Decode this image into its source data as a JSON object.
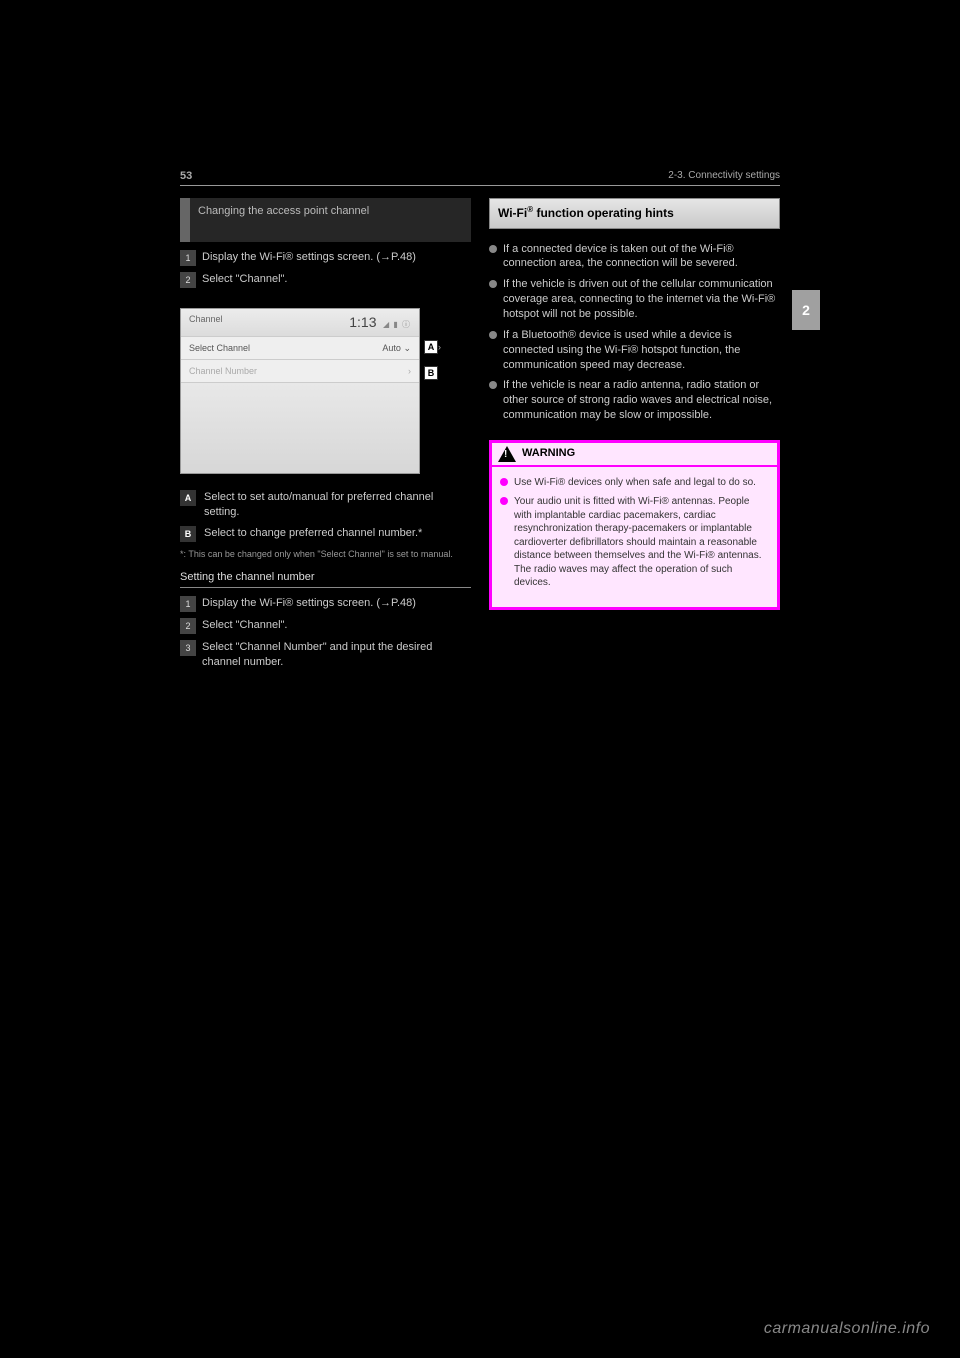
{
  "header": {
    "page_number": "53",
    "section_path": "2-3. Connectivity settings",
    "chapter_tab": "2"
  },
  "left_column": {
    "subsection_title": "Changing the access point channel",
    "steps_block1": [
      "Display the Wi-Fi® settings screen. (→P.48)",
      "Select \"Channel\"."
    ],
    "screenshot": {
      "title": "Channel",
      "time": "1:13",
      "status_icons": "◢ ▮ ⓘ",
      "row_select_label": "Select Channel",
      "row_select_value": "Auto",
      "row_select_chevron": "⌄",
      "row_select_mark": "A",
      "row_number_label": "Channel Number",
      "row_number_chevron": "›",
      "row_number_mark": "B"
    },
    "legend": [
      {
        "mark": "A",
        "text": "Select to set auto/manual for preferred channel setting."
      },
      {
        "mark": "B",
        "text": "Select to change preferred channel number.*"
      }
    ],
    "footnote": "*: This can be changed only when \"Select Channel\" is set to manual.",
    "subhead": "Setting the channel number",
    "steps_block2": [
      "Display the Wi-Fi® settings screen. (→P.48)",
      "Select \"Channel\".",
      "Select \"Channel Number\" and input the desired channel number."
    ]
  },
  "right_column": {
    "title_html": "Wi-Fi® function operating hints",
    "bullets": [
      "If a connected device is taken out of the Wi-Fi® connection area, the connection will be severed.",
      "If the vehicle is driven out of the cellular communication coverage area, connecting to the internet via the Wi-Fi® hotspot will not be possible.",
      "If a Bluetooth® device is used while a device is connected using the Wi-Fi® hotspot function, the communication speed may decrease.",
      "If the vehicle is near a radio antenna, radio station or other source of strong radio waves and electrical noise, communication may be slow or impossible."
    ],
    "warning": {
      "label": "WARNING",
      "items": [
        "Use Wi-Fi® devices only when safe and legal to do so.",
        "Your audio unit is fitted with Wi-Fi® antennas. People with implantable cardiac pacemakers, cardiac resynchronization therapy-pacemakers or implantable cardioverter defibrillators should maintain a reasonable distance between themselves and the Wi-Fi® antennas. The radio waves may affect the operation of such devices."
      ]
    }
  },
  "watermark": "carmanualsonline.info"
}
